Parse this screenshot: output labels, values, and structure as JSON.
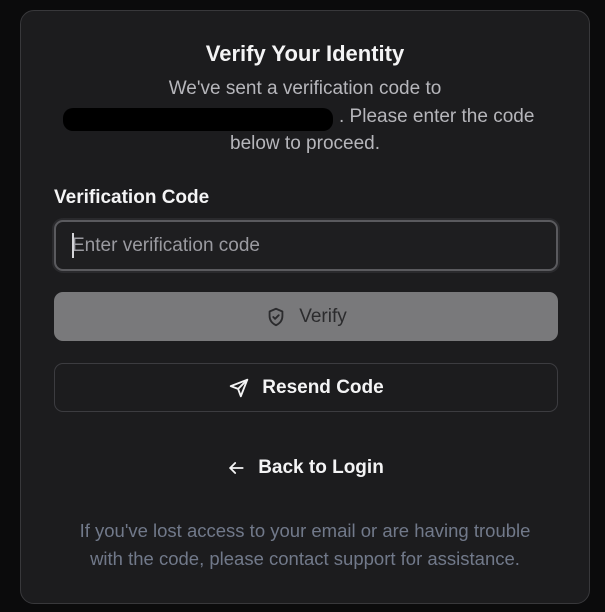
{
  "card": {
    "title": "Verify Your Identity",
    "description_line1": "We've sent a verification code to",
    "description_line2": ". Please enter the code",
    "description_line3": "below to proceed."
  },
  "form": {
    "label": "Verification Code",
    "input_placeholder": "Enter verification code",
    "input_value": ""
  },
  "buttons": {
    "verify_label": "Verify",
    "verify_icon": "shield-check-icon",
    "resend_label": "Resend Code",
    "resend_icon": "send-icon",
    "back_label": "Back to Login",
    "back_icon": "arrow-left-icon"
  },
  "help": {
    "line1": "If you've lost access to your email or are having trouble",
    "line2": "with the code, please contact support for assistance."
  },
  "colors": {
    "background": "#0b0b0c",
    "card": "#1c1c1e",
    "verify_button": "#79797b",
    "help_text": "#71798a"
  }
}
